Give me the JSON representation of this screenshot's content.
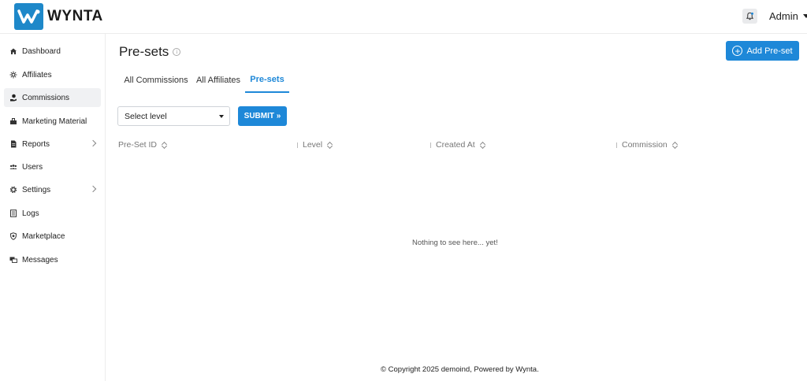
{
  "app": {
    "brand": "WYNTA"
  },
  "header": {
    "user": "Admin"
  },
  "sidebar": {
    "items": [
      {
        "label": "Dashboard",
        "icon": "home-icon"
      },
      {
        "label": "Affiliates",
        "icon": "network-icon"
      },
      {
        "label": "Commissions",
        "icon": "money-hand-icon",
        "active": true
      },
      {
        "label": "Marketing Material",
        "icon": "briefcase-icon"
      },
      {
        "label": "Reports",
        "icon": "document-icon",
        "has_submenu": true
      },
      {
        "label": "Users",
        "icon": "users-icon"
      },
      {
        "label": "Settings",
        "icon": "gear-icon",
        "has_submenu": true
      },
      {
        "label": "Logs",
        "icon": "logs-icon"
      },
      {
        "label": "Marketplace",
        "icon": "shield-icon"
      },
      {
        "label": "Messages",
        "icon": "messages-icon"
      }
    ]
  },
  "main": {
    "title": "Pre-sets",
    "info_glyph": "i",
    "add_button": "Add Pre-set",
    "tabs": [
      {
        "label": "All Commissions"
      },
      {
        "label": "All Affiliates"
      },
      {
        "label": "Pre-sets",
        "active": true
      }
    ],
    "filter": {
      "select_value": "Select level",
      "submit_label": "SUBMIT »"
    },
    "table": {
      "columns": [
        "Pre-Set ID",
        "Level",
        "Created At",
        "Commission"
      ],
      "empty_message": "Nothing to see here... yet!"
    }
  },
  "footer": {
    "text": "© Copyright 2025 demoind, Powered by Wynta."
  },
  "colors": {
    "accent": "#1e88d8",
    "brand": "#1e88c9"
  }
}
